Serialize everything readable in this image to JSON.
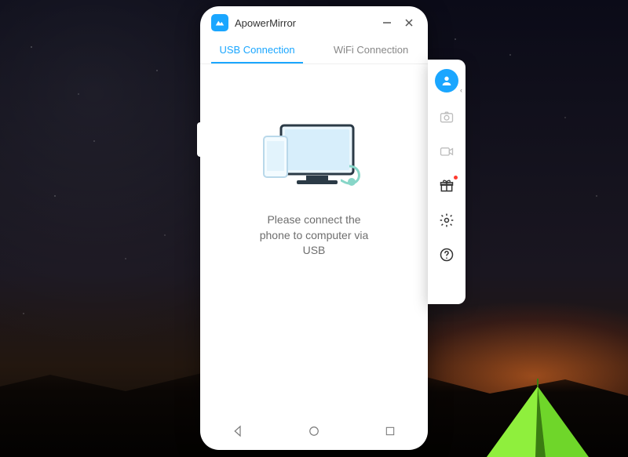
{
  "app": {
    "title": "ApowerMirror"
  },
  "tabs": {
    "usb": "USB Connection",
    "wifi": "WiFi Connection"
  },
  "content": {
    "message": "Please connect the phone to computer via USB"
  },
  "sidepanel": {
    "items": [
      {
        "name": "profile-icon"
      },
      {
        "name": "camera-icon"
      },
      {
        "name": "record-icon"
      },
      {
        "name": "gift-icon"
      },
      {
        "name": "settings-icon"
      },
      {
        "name": "help-icon"
      }
    ]
  }
}
